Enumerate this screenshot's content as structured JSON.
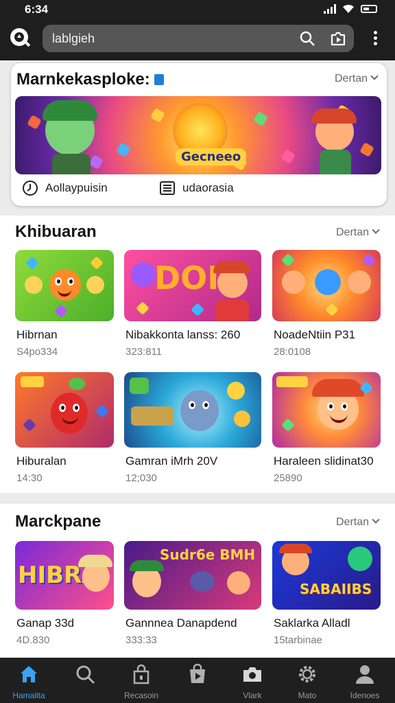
{
  "status": {
    "time": "6:34"
  },
  "search": {
    "query": "lablgieh"
  },
  "featured": {
    "title": "Marnkekasploke:",
    "more": "Dertan",
    "banner_text": "Gecneeo",
    "meta1": "Aollaypuisin",
    "meta2": "udaorasia"
  },
  "sections": [
    {
      "title": "Khibuaran",
      "more": "Dertan",
      "items": [
        {
          "name": "Hibrnan",
          "sub": "S4po334"
        },
        {
          "name": "Nibakkonta lanss: 260",
          "sub": "323:811"
        },
        {
          "name": "NoadeNtiin P31",
          "sub": "28:0108"
        },
        {
          "name": "Hiburalan",
          "sub": "14:30"
        },
        {
          "name": "Gamran iMrh 20V",
          "sub": "12;030"
        },
        {
          "name": "Haraleen slidinat30",
          "sub": "25890"
        }
      ]
    },
    {
      "title": "Marckpane",
      "more": "Dertan",
      "items": [
        {
          "name": "Ganap 33d",
          "sub": "4D.830",
          "art": "HIBRA"
        },
        {
          "name": "Gannnea Danapdend",
          "sub": "333:33",
          "art": "Sudr6e BMH"
        },
        {
          "name": "Saklarka Alladl",
          "sub": "15tarbinae",
          "art": "SABAIIBS"
        }
      ]
    }
  ],
  "nav": [
    {
      "label": "Hamalita",
      "icon": "home-icon",
      "active": true
    },
    {
      "label": "",
      "icon": "search-icon"
    },
    {
      "label": "Recasoin",
      "icon": "lock-bag-icon"
    },
    {
      "label": "",
      "icon": "bag-play-icon"
    },
    {
      "label": "Vlark",
      "icon": "camera-icon"
    },
    {
      "label": "Mato",
      "icon": "gear-icon"
    },
    {
      "label": "Idenoes",
      "icon": "person-icon"
    }
  ],
  "colors": {
    "accent": "#3aa3f0",
    "bar": "#1e1e1e",
    "pin": "#1e7fd8"
  }
}
